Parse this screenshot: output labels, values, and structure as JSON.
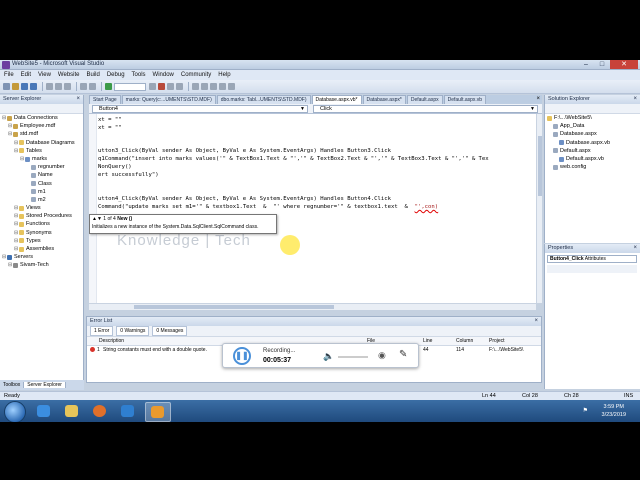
{
  "window": {
    "title": "WebSite5 - Microsoft Visual Studio",
    "buttons": {
      "minimize": "–",
      "maximize": "□",
      "close": "✕"
    }
  },
  "menu": [
    "File",
    "Edit",
    "View",
    "Website",
    "Build",
    "Debug",
    "Tools",
    "Window",
    "Community",
    "Help"
  ],
  "left_pane": {
    "title": "Server Explorer",
    "close": "×",
    "tree": [
      {
        "label": "Data Connections",
        "level": 0,
        "icon": "database-icon"
      },
      {
        "label": "Employee.mdf",
        "level": 1,
        "icon": "database-icon"
      },
      {
        "label": "std.mdf",
        "level": 1,
        "icon": "database-icon"
      },
      {
        "label": "Database Diagrams",
        "level": 2,
        "icon": "folder-icon"
      },
      {
        "label": "Tables",
        "level": 2,
        "icon": "folder-icon"
      },
      {
        "label": "marks",
        "level": 3,
        "icon": "table-icon"
      },
      {
        "label": "regnumber",
        "level": 4,
        "icon": "column-icon"
      },
      {
        "label": "Name",
        "level": 4,
        "icon": "column-icon"
      },
      {
        "label": "Class",
        "level": 4,
        "icon": "column-icon"
      },
      {
        "label": "m1",
        "level": 4,
        "icon": "column-icon"
      },
      {
        "label": "m2",
        "level": 4,
        "icon": "column-icon"
      },
      {
        "label": "Views",
        "level": 2,
        "icon": "folder-icon"
      },
      {
        "label": "Stored Procedures",
        "level": 2,
        "icon": "folder-icon"
      },
      {
        "label": "Functions",
        "level": 2,
        "icon": "folder-icon"
      },
      {
        "label": "Synonyms",
        "level": 2,
        "icon": "folder-icon"
      },
      {
        "label": "Types",
        "level": 2,
        "icon": "folder-icon"
      },
      {
        "label": "Assemblies",
        "level": 2,
        "icon": "folder-icon"
      },
      {
        "label": "Servers",
        "level": 0,
        "icon": "server-icon"
      },
      {
        "label": "Sivam-Tech",
        "level": 1,
        "icon": "computer-icon"
      }
    ],
    "bottom_tabs": [
      "Toolbox",
      "Server Explorer"
    ]
  },
  "editor": {
    "tabs": [
      {
        "label": "Start Page",
        "active": false
      },
      {
        "label": "marks: Query(c:...UMENTS\\STD.MDF)",
        "active": false
      },
      {
        "label": "dbo.marks: Tabl...UMENTS\\STD.MDF)",
        "active": false
      },
      {
        "label": "Database.aspx.vb*",
        "active": true
      },
      {
        "label": "Database.aspx*",
        "active": false
      },
      {
        "label": "Default.aspx",
        "active": false
      },
      {
        "label": "Default.aspx.vb",
        "active": false
      }
    ],
    "close_tab": "×",
    "dropdown_left": "Button4",
    "dropdown_right": "Click",
    "code": {
      "l1": "xt = \"\"",
      "l2": "xt = \"\"",
      "l3": "utton3_Click(ByVal sender As Object, ByVal e As System.EventArgs) Handles Button3.Click",
      "l4": "q1Command(\"insert into marks values('\" & TextBox1.Text & \"','\" & TextBox2.Text & \"','\" & TextBox3.Text & \"','\" & Tex",
      "l5": "NonQuery()",
      "l6": "ert successfully\")",
      "l7": "utton4_Click(ByVal sender As Object, ByVal e As System.EventArgs) Handles Button4.Click",
      "l8a": "Command(\"",
      "l8b": "update marks set m1='\" & textbox1.Text  &  \"' where regnumber='\" & textbox1.text  &  ",
      "l8c": "\"',con)"
    },
    "intellisense": {
      "count": "1 of 4",
      "sig": "New ()",
      "desc": "Initializes a new instance of the System.Data.SqlClient.SqlCommand class."
    },
    "watermark": "Knowledge | Tech"
  },
  "error_list": {
    "title": "Error List",
    "close": "×",
    "filters": [
      "1 Error",
      "0 Warnings",
      "0 Messages"
    ],
    "columns": [
      "",
      "Description",
      "File",
      "Line",
      "Column",
      "Project"
    ],
    "rows": [
      {
        "num": "1",
        "description": "String constants must end with a double quote.",
        "file": "",
        "line": "44",
        "column": "114",
        "project": "F:\\...\\WebSite5\\"
      }
    ]
  },
  "recorder": {
    "label": "Recording...",
    "time": "00:05:37"
  },
  "solution_explorer": {
    "title": "Solution Explorer",
    "close": "×",
    "tree": [
      {
        "label": "F:\\...\\WebSite5\\",
        "level": 0
      },
      {
        "label": "App_Data",
        "level": 1
      },
      {
        "label": "Database.aspx",
        "level": 1
      },
      {
        "label": "Database.aspx.vb",
        "level": 2
      },
      {
        "label": "Default.aspx",
        "level": 1
      },
      {
        "label": "Default.aspx.vb",
        "level": 2
      },
      {
        "label": "web.config",
        "level": 1
      }
    ]
  },
  "properties": {
    "title": "Properties",
    "close": "×",
    "object": "Button4_Click",
    "object_type": "Attributes"
  },
  "status_bar": {
    "ready": "Ready",
    "line": "Ln 44",
    "col": "Col 28",
    "ch": "Ch 28",
    "ins": "INS"
  },
  "taskbar": {
    "time": "3:59 PM",
    "date": "3/23/2019"
  },
  "colors": {
    "keyword": "#0000ff",
    "string": "#a31515",
    "error": "#d8322a"
  }
}
